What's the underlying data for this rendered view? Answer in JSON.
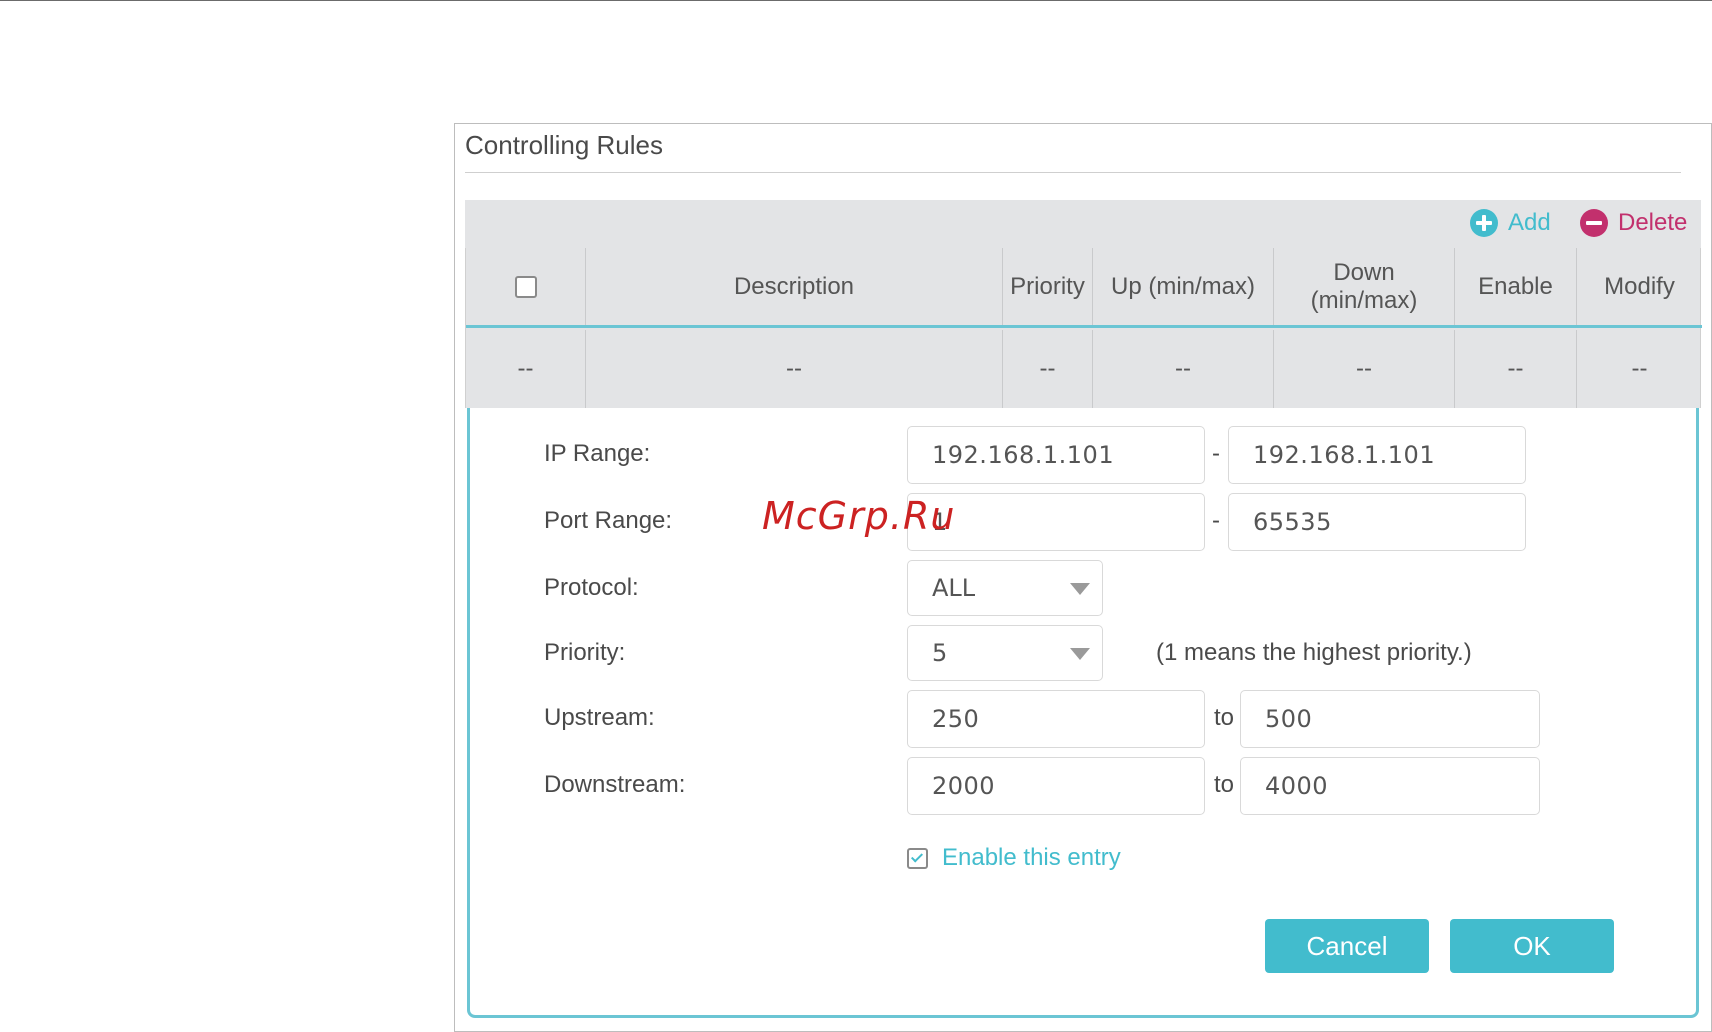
{
  "panel": {
    "title": "Controlling Rules"
  },
  "toolbar": {
    "add_label": "Add",
    "delete_label": "Delete"
  },
  "table": {
    "headers": [
      "Description",
      "Priority",
      "Up (min/max)",
      "Down (min/max)",
      "Enable",
      "Modify"
    ],
    "header_down_line1": "Down",
    "header_down_line2": "(min/max)",
    "row": [
      "--",
      "--",
      "--",
      "--",
      "--",
      "--",
      "--"
    ]
  },
  "form": {
    "ip_range_label": "IP Range:",
    "ip_start": "192.168.1.101",
    "ip_end": "192.168.1.101",
    "port_range_label": "Port Range:",
    "port_start": "1",
    "port_end": "65535",
    "protocol_label": "Protocol:",
    "protocol_value": "ALL",
    "priority_label": "Priority:",
    "priority_value": "5",
    "priority_hint": "(1 means the highest priority.)",
    "upstream_label": "Upstream:",
    "upstream_min": "250",
    "upstream_max": "500",
    "downstream_label": "Downstream:",
    "downstream_min": "2000",
    "downstream_max": "4000",
    "range_separator": "-",
    "to_label": "to",
    "enable_label": "Enable this entry",
    "enable_checked": true,
    "cancel_label": "Cancel",
    "ok_label": "OK"
  },
  "watermark": "McGrp.Ru",
  "colors": {
    "accent": "#42bccd",
    "delete": "#c2306d",
    "table_bg": "#e3e4e6",
    "watermark": "#cc2222"
  }
}
